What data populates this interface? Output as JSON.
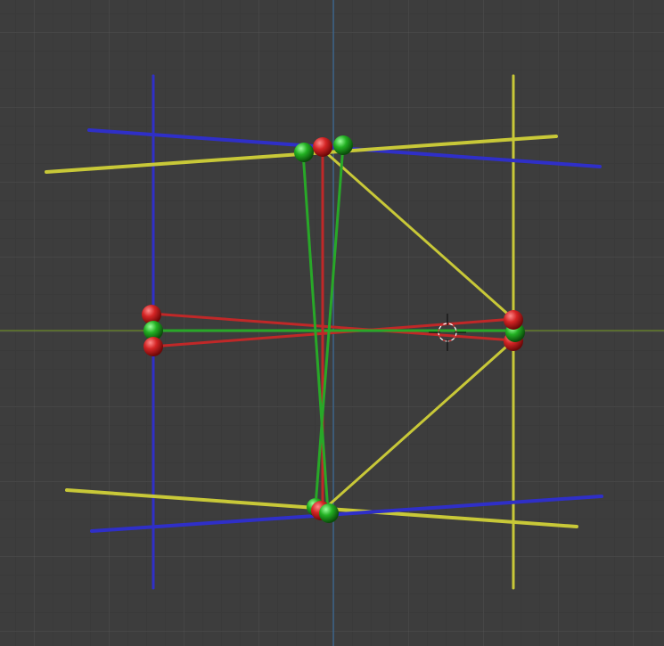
{
  "viewport": {
    "grid": true,
    "background_color": "#3d3d3d"
  },
  "colors": {
    "x_axis": "#6b8a2a",
    "y_axis": "#3a6a9a",
    "blue_rod": "#2f2fc8",
    "yellow_rod": "#c8c838",
    "red_rod": "#c02828",
    "green_rod": "#28a828",
    "red_sphere": "#c81e1e",
    "green_sphere": "#22b022"
  },
  "icons": {
    "cursor": "3d-cursor-icon"
  }
}
